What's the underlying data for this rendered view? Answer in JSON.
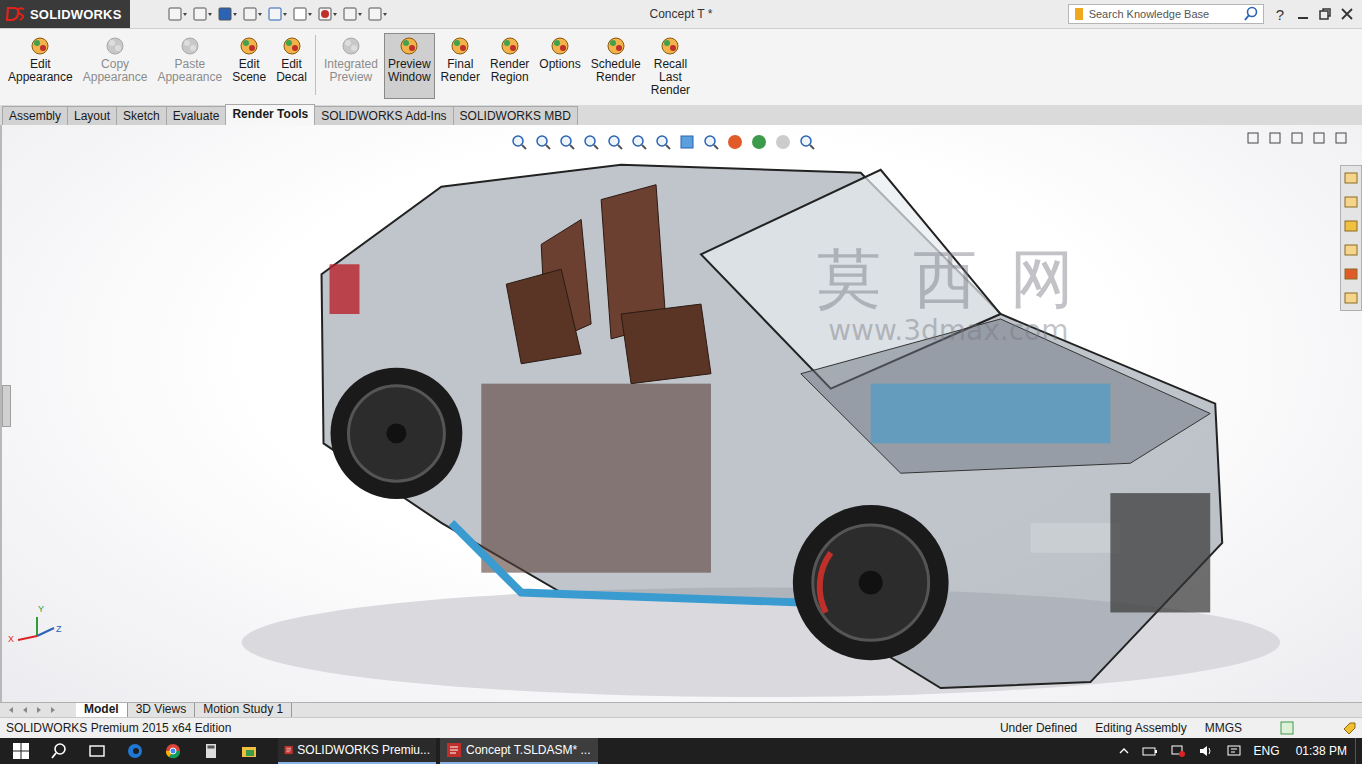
{
  "app": {
    "logo": "SOLIDWORKS"
  },
  "window": {
    "title": "Concept T *"
  },
  "search": {
    "placeholder": "Search Knowledge Base"
  },
  "help": "?",
  "commands": [
    {
      "lines": [
        "Edit",
        "Appearance"
      ],
      "disabled": false,
      "selected": false
    },
    {
      "lines": [
        "Copy",
        "Appearance"
      ],
      "disabled": true,
      "selected": false
    },
    {
      "lines": [
        "Paste",
        "Appearance"
      ],
      "disabled": true,
      "selected": false
    },
    {
      "lines": [
        "Edit",
        "Scene"
      ],
      "disabled": false,
      "selected": false
    },
    {
      "lines": [
        "Edit",
        "Decal"
      ],
      "disabled": false,
      "selected": false
    },
    {
      "lines": [
        "Integrated",
        "Preview"
      ],
      "disabled": true,
      "selected": false
    },
    {
      "lines": [
        "Preview",
        "Window"
      ],
      "disabled": false,
      "selected": true
    },
    {
      "lines": [
        "Final",
        "Render"
      ],
      "disabled": false,
      "selected": false
    },
    {
      "lines": [
        "Render",
        "Region"
      ],
      "disabled": false,
      "selected": false
    },
    {
      "lines": [
        "Options"
      ],
      "disabled": false,
      "selected": false
    },
    {
      "lines": [
        "Schedule",
        "Render"
      ],
      "disabled": false,
      "selected": false
    },
    {
      "lines": [
        "Recall",
        "Last",
        "Render"
      ],
      "disabled": false,
      "selected": false
    }
  ],
  "tabs": [
    {
      "label": "Assembly",
      "selected": false
    },
    {
      "label": "Layout",
      "selected": false
    },
    {
      "label": "Sketch",
      "selected": false
    },
    {
      "label": "Evaluate",
      "selected": false
    },
    {
      "label": "Render Tools",
      "selected": true
    },
    {
      "label": "SOLIDWORKS Add-Ins",
      "selected": false
    },
    {
      "label": "SOLIDWORKS MBD",
      "selected": false
    }
  ],
  "watermark": {
    "chinese": "莫 西 网",
    "url": "www.3dmax.com"
  },
  "triad": {
    "y": "Y",
    "x": "X",
    "z": "Z"
  },
  "view_tabs": [
    {
      "label": "Model",
      "selected": true
    },
    {
      "label": "3D Views",
      "selected": false
    },
    {
      "label": "Motion Study 1",
      "selected": false
    }
  ],
  "status_bar": {
    "edition": "SOLIDWORKS Premium 2015 x64 Edition",
    "items": [
      "Under Defined",
      "Editing Assembly",
      "MMGS"
    ]
  },
  "taskbar": {
    "tasks": [
      {
        "label": "SOLIDWORKS Premiu...",
        "selected": false
      },
      {
        "label": "Concept T.SLDASM* ...",
        "selected": true
      }
    ],
    "language": "ENG",
    "time": "01:38 PM"
  }
}
